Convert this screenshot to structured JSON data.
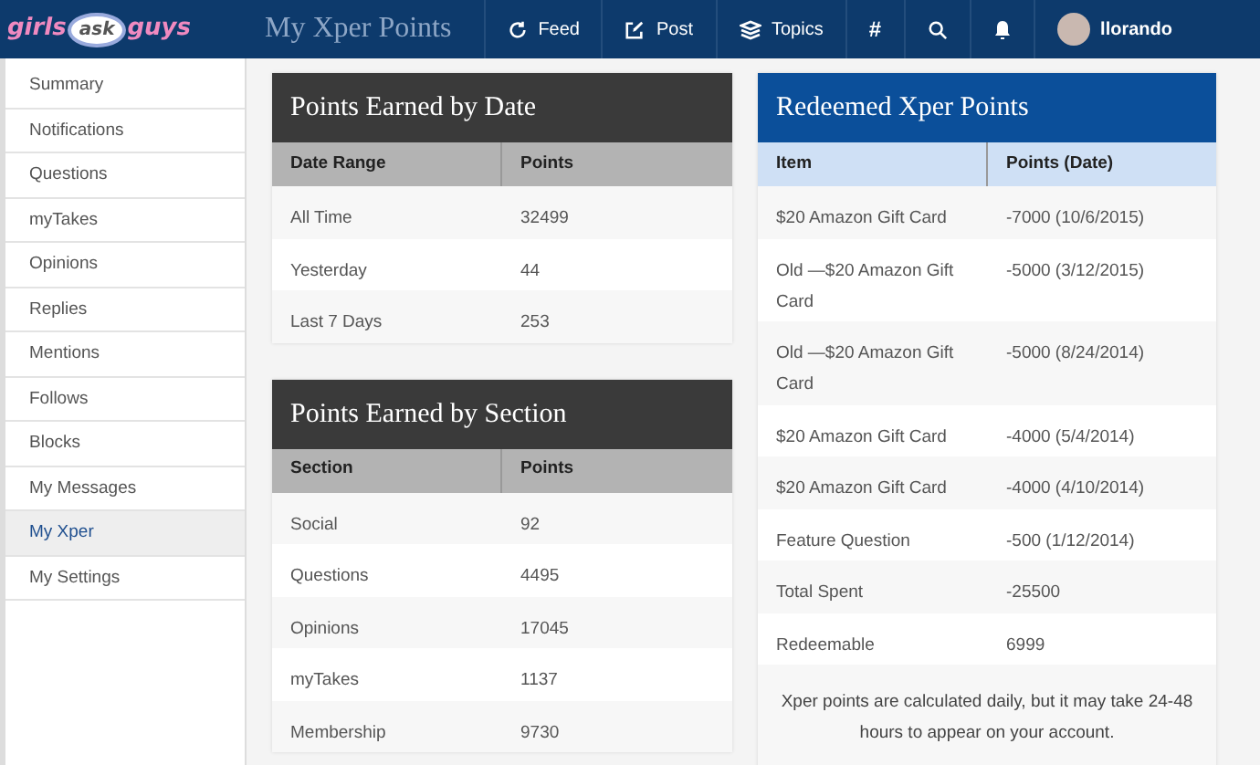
{
  "navbar": {
    "logo": [
      "girls",
      "ask",
      "guys"
    ],
    "page_title": "My Xper Points",
    "items": [
      {
        "kind": "link",
        "label": "Feed"
      },
      {
        "kind": "link",
        "label": "Post"
      },
      {
        "kind": "link",
        "label": "Topics"
      },
      {
        "kind": "link",
        "label": "#"
      },
      {
        "kind": "icon"
      },
      {
        "kind": "icon"
      }
    ],
    "user": {
      "name": "llorando"
    }
  },
  "sidebar": {
    "items": [
      {
        "label": "Summary",
        "selected": false
      },
      {
        "label": "Notifications",
        "selected": false
      },
      {
        "label": "Questions",
        "selected": false
      },
      {
        "label": "myTakes",
        "selected": false
      },
      {
        "label": "Opinions",
        "selected": false
      },
      {
        "label": "Replies",
        "selected": false
      },
      {
        "label": "Mentions",
        "selected": false
      },
      {
        "label": "Follows",
        "selected": false
      },
      {
        "label": "Blocks",
        "selected": false
      },
      {
        "label": "My Messages",
        "selected": false
      },
      {
        "label": "My Xper",
        "selected": true
      },
      {
        "label": "My Settings",
        "selected": false
      }
    ]
  },
  "points_by_date": {
    "title": "Points Earned by Date",
    "columns": [
      "Date Range",
      "Points"
    ],
    "rows": [
      [
        "All Time",
        "32499"
      ],
      [
        "Yesterday",
        "44"
      ],
      [
        "Last 7 Days",
        "253"
      ]
    ]
  },
  "points_by_section": {
    "title": "Points Earned by Section",
    "columns": [
      "Section",
      "Points"
    ],
    "rows": [
      [
        "Social",
        "92"
      ],
      [
        "Questions",
        "4495"
      ],
      [
        "Opinions",
        "17045"
      ],
      [
        "myTakes",
        "1137"
      ],
      [
        "Membership",
        "9730"
      ]
    ]
  },
  "redeemed": {
    "title": "Redeemed Xper Points",
    "columns": [
      "Item",
      "Points (Date)"
    ],
    "rows": [
      [
        "$20 Amazon Gift Card",
        "-7000 (10/6/2015)"
      ],
      [
        "Old —$20 Amazon Gift Card",
        "-5000 (3/12/2015)"
      ],
      [
        "Old —$20 Amazon Gift Card",
        "-5000 (8/24/2014)"
      ],
      [
        "$20 Amazon Gift Card",
        "-4000 (5/4/2014)"
      ],
      [
        "$20 Amazon Gift Card",
        "-4000 (4/10/2014)"
      ],
      [
        "Feature Question",
        "-500 (1/12/2014)"
      ],
      [
        "Total Spent",
        "-25500"
      ],
      [
        "Redeemable",
        "6999"
      ]
    ],
    "note": "Xper points are calculated daily, but it may take 24-48 hours to appear on your account."
  }
}
